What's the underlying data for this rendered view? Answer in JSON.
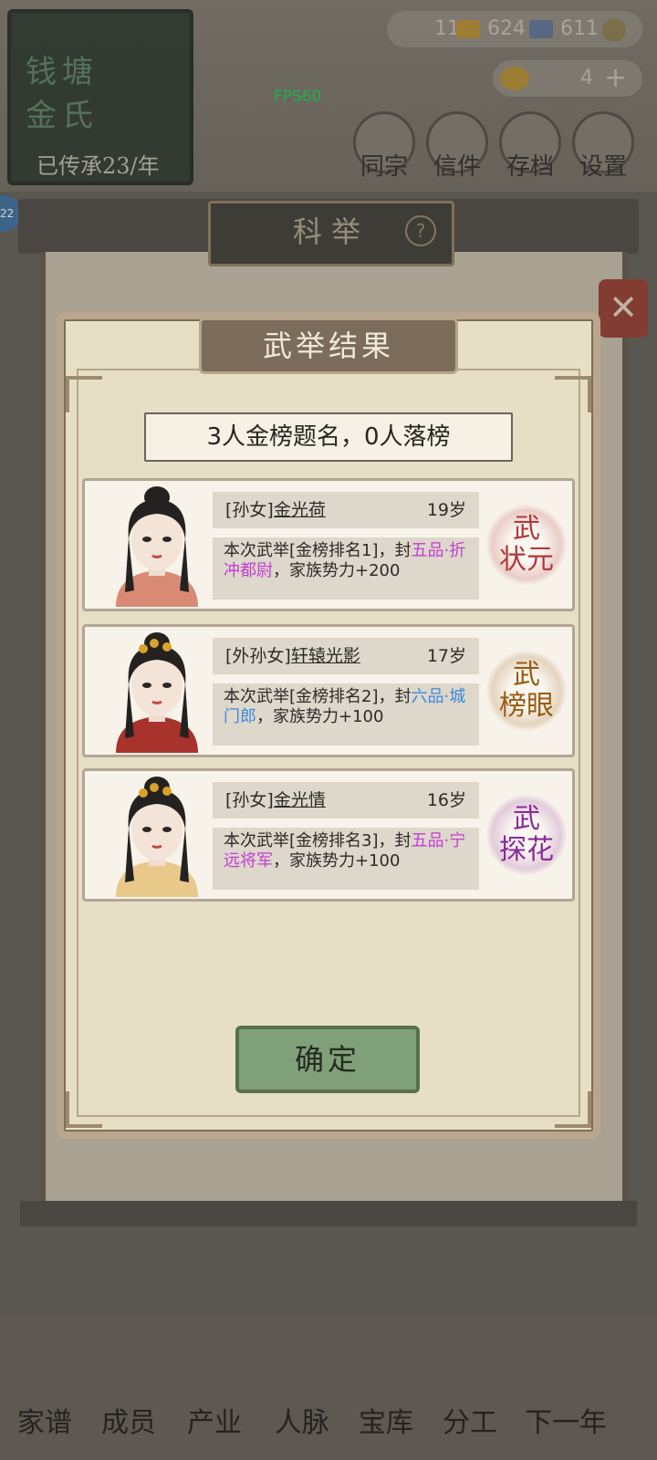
{
  "background": {
    "family_name": "钱塘金氏",
    "inherited_years": "已传承23/年",
    "fps": "FPS60",
    "resources": {
      "r1": "11",
      "r2": "624",
      "r3": "611",
      "gold": "4"
    },
    "side_badge": "22",
    "top_buttons": [
      "同宗",
      "信件",
      "存档",
      "设置"
    ],
    "exam_title": "科举",
    "help_symbol": "?",
    "close_symbol": "✕",
    "bottom_nav": [
      "家谱",
      "成员",
      "产业",
      "人脉",
      "宝库",
      "分工",
      "下一年"
    ]
  },
  "dialog": {
    "title": "武举结果",
    "summary": "3人金榜题名，0人落榜",
    "results": [
      {
        "relation": "[孙女]",
        "name": "金光荷",
        "age": "19岁",
        "desc_prefix": "本次武举[金榜排名1]，封",
        "rank": "五品·折冲都尉",
        "desc_suffix": "，家族势力+200",
        "rank_color": "#c13fd0",
        "stamp_top": "武",
        "stamp_bottom": "状元",
        "stamp_color": "#b3373a"
      },
      {
        "relation": "[外孙女]",
        "name": "轩辕光影",
        "age": "17岁",
        "desc_prefix": "本次武举[金榜排名2]，封",
        "rank": "六品·城门郎",
        "desc_suffix": "，家族势力+100",
        "rank_color": "#3c8ad9",
        "stamp_top": "武",
        "stamp_bottom": "榜眼",
        "stamp_color": "#9a5a12"
      },
      {
        "relation": "[孙女]",
        "name": "金光情",
        "age": "16岁",
        "desc_prefix": "本次武举[金榜排名3]，封",
        "rank": "五品·宁远将军",
        "desc_suffix": "，家族势力+100",
        "rank_color": "#c13fd0",
        "stamp_top": "武",
        "stamp_bottom": "探花",
        "stamp_color": "#8a2a9a"
      }
    ],
    "confirm_label": "确定"
  }
}
